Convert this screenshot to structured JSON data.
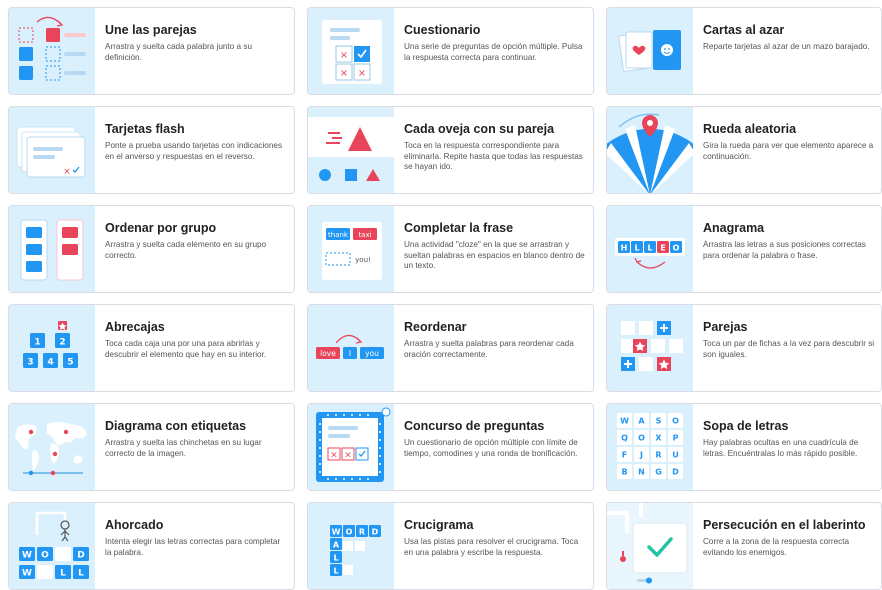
{
  "activities": [
    {
      "title": "Une las parejas",
      "description": "Arrastra y suelta cada palabra junto a su definición.",
      "icon": "match-pairs-icon"
    },
    {
      "title": "Cuestionario",
      "description": "Una serie de preguntas de opción múltiple. Pulsa la respuesta correcta para continuar.",
      "icon": "quiz-icon"
    },
    {
      "title": "Cartas al azar",
      "description": "Reparte tarjetas al azar de un mazo barajado.",
      "icon": "random-cards-icon"
    },
    {
      "title": "Tarjetas flash",
      "description": "Ponte a prueba usando tarjetas con indicaciones en el anverso y respuestas en el reverso.",
      "icon": "flash-cards-icon"
    },
    {
      "title": "Cada oveja con su pareja",
      "description": "Toca en la respuesta correspondiente para eliminarla. Repite hasta que todas las respuestas se hayan ido.",
      "icon": "find-match-icon"
    },
    {
      "title": "Rueda aleatoria",
      "description": "Gira la rueda para ver que elemento aparece a continuación.",
      "icon": "random-wheel-icon"
    },
    {
      "title": "Ordenar por grupo",
      "description": "Arrastra y suelta cada elemento en su grupo correcto.",
      "icon": "group-sort-icon"
    },
    {
      "title": "Completar la frase",
      "description": "Una actividad \"cloze\" en la que se arrastran y sueltan palabras en espacios en blanco dentro de un texto.",
      "icon": "complete-sentence-icon",
      "chips": [
        "thank",
        "taxi",
        "you!"
      ]
    },
    {
      "title": "Anagrama",
      "description": "Arrastra las letras a sus posiciones correctas para ordenar la palabra o frase.",
      "icon": "anagram-icon",
      "letters": [
        "H",
        "L",
        "L",
        "E",
        "O"
      ]
    },
    {
      "title": "Abrecajas",
      "description": "Toca cada caja una por una para abrirlas y descubrir el elemento que hay en su interior.",
      "icon": "open-box-icon",
      "numbers": [
        "1",
        "2",
        "3",
        "4",
        "5"
      ]
    },
    {
      "title": "Reordenar",
      "description": "Arrastra y suelta palabras para reordenar cada oración correctamente.",
      "icon": "unjumble-icon",
      "words": [
        "love",
        "I",
        "you"
      ]
    },
    {
      "title": "Parejas",
      "description": "Toca un par de fichas a la vez para descubrir si son iguales.",
      "icon": "matching-pairs-tiles-icon"
    },
    {
      "title": "Diagrama con etiquetas",
      "description": "Arrastra y suelta las chinchetas en su lugar correcto de la imagen.",
      "icon": "labelled-diagram-icon"
    },
    {
      "title": "Concurso de preguntas",
      "description": "Un cuestionario de opción múltiple con límite de tiempo, comodines y una ronda de bonificación.",
      "icon": "gameshow-quiz-icon"
    },
    {
      "title": "Sopa de letras",
      "description": "Hay palabras ocultas en una cuadrícula de letras. Encuéntralas lo más rápido posible.",
      "icon": "wordsearch-icon",
      "grid": [
        "W",
        "A",
        "S",
        "O",
        "Q",
        "O",
        "X",
        "P",
        "F",
        "J",
        "R",
        "U",
        "B",
        "N",
        "G",
        "D"
      ]
    },
    {
      "title": "Ahorcado",
      "description": "Intenta elegir las letras correctas para completar la palabra.",
      "icon": "hangman-icon",
      "letters": [
        "W",
        "O",
        "D",
        "W",
        "L",
        "L"
      ]
    },
    {
      "title": "Crucigrama",
      "description": "Usa las pistas para resolver el crucigrama. Toca en una palabra y escribe la respuesta.",
      "icon": "crossword-icon",
      "letters": [
        "W",
        "O",
        "R",
        "D",
        "A",
        "L",
        "L"
      ]
    },
    {
      "title": "Persecución en el laberinto",
      "description": "Corre a la zona de la respuesta correcta evitando los enemigos.",
      "icon": "maze-chase-icon"
    }
  ]
}
